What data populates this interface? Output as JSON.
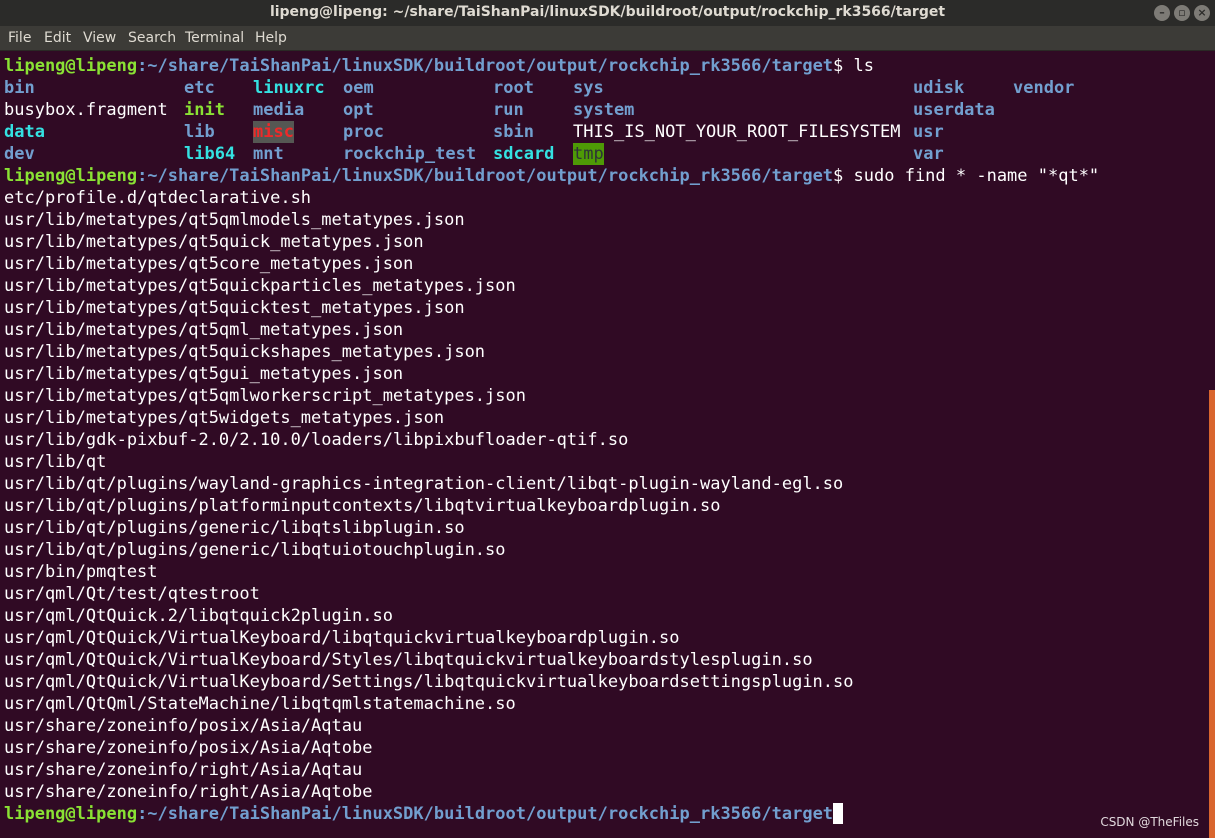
{
  "window": {
    "title": "lipeng@lipeng: ~/share/TaiShanPai/linuxSDK/buildroot/output/rockchip_rk3566/target",
    "controls": [
      "minimize",
      "maximize",
      "close"
    ]
  },
  "menu": [
    "File",
    "Edit",
    "View",
    "Search",
    "Terminal",
    "Help"
  ],
  "prompt": {
    "user": "lipeng@lipeng",
    "path": ":~/share/TaiShanPai/linuxSDK/buildroot/output/rockchip_rk3566/target",
    "symbol": "$"
  },
  "commands": [
    "ls",
    "sudo find * -name \"*qt*\""
  ],
  "ls_rows": [
    [
      {
        "text": "bin",
        "type": "dir"
      },
      {
        "text": "etc",
        "type": "dir"
      },
      {
        "text": "linuxrc",
        "type": "link"
      },
      {
        "text": "oem",
        "type": "dir"
      },
      {
        "text": "root",
        "type": "dir"
      },
      {
        "text": "sys",
        "type": "dir"
      },
      {
        "text": "udisk",
        "type": "dir"
      },
      {
        "text": "vendor",
        "type": "dir"
      }
    ],
    [
      {
        "text": "busybox.fragment",
        "type": "plain"
      },
      {
        "text": "init",
        "type": "exe"
      },
      {
        "text": "media",
        "type": "dir"
      },
      {
        "text": "opt",
        "type": "dir"
      },
      {
        "text": "run",
        "type": "dir"
      },
      {
        "text": "system",
        "type": "dir"
      },
      {
        "text": "userdata",
        "type": "dir"
      }
    ],
    [
      {
        "text": "data",
        "type": "link"
      },
      {
        "text": "lib",
        "type": "dir"
      },
      {
        "text": "misc",
        "type": "misc"
      },
      {
        "text": "proc",
        "type": "dir"
      },
      {
        "text": "sbin",
        "type": "dir"
      },
      {
        "text": "THIS_IS_NOT_YOUR_ROOT_FILESYSTEM",
        "type": "plain"
      },
      {
        "text": "usr",
        "type": "dir"
      }
    ],
    [
      {
        "text": "dev",
        "type": "dir"
      },
      {
        "text": "lib64",
        "type": "link"
      },
      {
        "text": "mnt",
        "type": "dir"
      },
      {
        "text": "rockchip_test",
        "type": "dir"
      },
      {
        "text": "sdcard",
        "type": "link"
      },
      {
        "text": "tmp",
        "type": "tmp"
      },
      {
        "text": "var",
        "type": "dir"
      }
    ]
  ],
  "find_results": [
    "etc/profile.d/qtdeclarative.sh",
    "usr/lib/metatypes/qt5qmlmodels_metatypes.json",
    "usr/lib/metatypes/qt5quick_metatypes.json",
    "usr/lib/metatypes/qt5core_metatypes.json",
    "usr/lib/metatypes/qt5quickparticles_metatypes.json",
    "usr/lib/metatypes/qt5quicktest_metatypes.json",
    "usr/lib/metatypes/qt5qml_metatypes.json",
    "usr/lib/metatypes/qt5quickshapes_metatypes.json",
    "usr/lib/metatypes/qt5gui_metatypes.json",
    "usr/lib/metatypes/qt5qmlworkerscript_metatypes.json",
    "usr/lib/metatypes/qt5widgets_metatypes.json",
    "usr/lib/gdk-pixbuf-2.0/2.10.0/loaders/libpixbufloader-qtif.so",
    "usr/lib/qt",
    "usr/lib/qt/plugins/wayland-graphics-integration-client/libqt-plugin-wayland-egl.so",
    "usr/lib/qt/plugins/platforminputcontexts/libqtvirtualkeyboardplugin.so",
    "usr/lib/qt/plugins/generic/libqtslibplugin.so",
    "usr/lib/qt/plugins/generic/libqtuiotouchplugin.so",
    "usr/bin/pmqtest",
    "usr/qml/Qt/test/qtestroot",
    "usr/qml/QtQuick.2/libqtquick2plugin.so",
    "usr/qml/QtQuick/VirtualKeyboard/libqtquickvirtualkeyboardplugin.so",
    "usr/qml/QtQuick/VirtualKeyboard/Styles/libqtquickvirtualkeyboardstylesplugin.so",
    "usr/qml/QtQuick/VirtualKeyboard/Settings/libqtquickvirtualkeyboardsettingsplugin.so",
    "usr/qml/QtQml/StateMachine/libqtqmlstatemachine.so",
    "usr/share/zoneinfo/posix/Asia/Aqtau",
    "usr/share/zoneinfo/posix/Asia/Aqtobe",
    "usr/share/zoneinfo/right/Asia/Aqtau",
    "usr/share/zoneinfo/right/Asia/Aqtobe"
  ],
  "watermark": "CSDN @TheFiles",
  "colors": {
    "background": "#300a24",
    "prompt_user": "#8ae234",
    "prompt_path": "#729fcf",
    "directory": "#729fcf",
    "symlink": "#34e2e2",
    "executable": "#8ae234",
    "scrollbar": "#d9652e"
  }
}
